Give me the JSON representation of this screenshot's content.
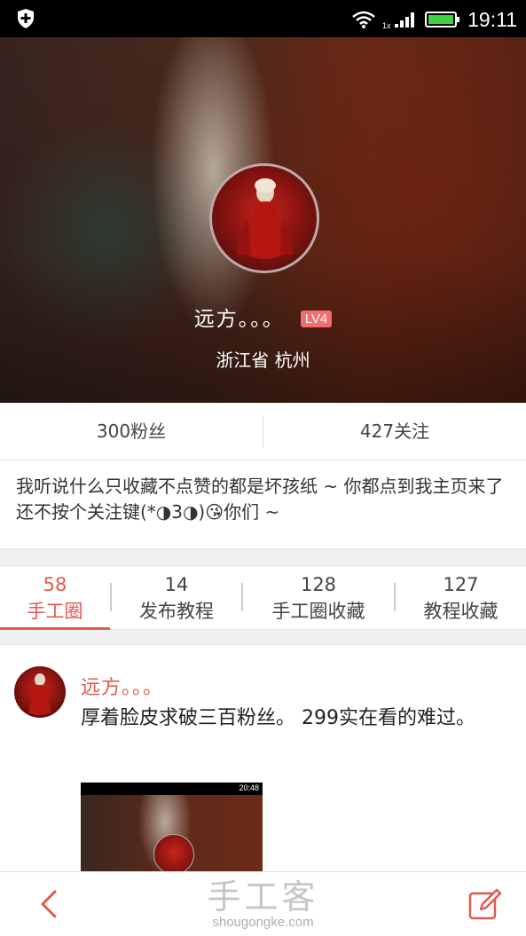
{
  "status_bar": {
    "time": "19:11",
    "network": "1x"
  },
  "profile": {
    "name": "远方。。。",
    "level": "LV4",
    "location": "浙江省 杭州"
  },
  "stats": {
    "followers": "300粉丝",
    "following": "427关注"
  },
  "bio": "我听说什么只收藏不点赞的都是坏孩纸 ~ 你都点到我主页来了还不按个关注键(*◑3◑)😘你们 ~",
  "tabs": [
    {
      "count": "58",
      "label": "手工圈"
    },
    {
      "count": "14",
      "label": "发布教程"
    },
    {
      "count": "128",
      "label": "手工圈收藏"
    },
    {
      "count": "127",
      "label": "教程收藏"
    }
  ],
  "post": {
    "author": "远方。。。",
    "text": "厚着脸皮求破三百粉丝。 299实在看的难过。",
    "thumb_time": "20:48"
  },
  "watermark": {
    "title": "手工客",
    "url": "shougongke.com"
  },
  "colors": {
    "accent": "#e05a50",
    "badge": "#f26d6d"
  },
  "icons": {
    "back": "back-arrow-icon",
    "edit": "edit-icon"
  }
}
